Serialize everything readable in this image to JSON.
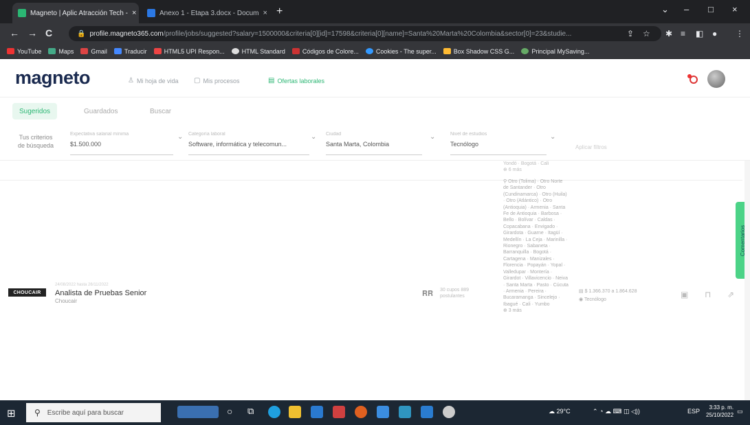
{
  "browser": {
    "tabs": [
      {
        "label": "Magneto | Aplic Atracción Tech - ",
        "close": "×"
      },
      {
        "label": "Anexo 1 - Etapa 3.docx - Docum",
        "close": "×"
      }
    ],
    "new_tab": "+",
    "window_controls": {
      "minimize": "–",
      "maximize": "□",
      "close": "×",
      "tab_search": "⌄"
    },
    "nav": {
      "back": "←",
      "forward": "→",
      "reload": "C"
    },
    "url_host": "profile.magneto365.com",
    "url_rest": "/profile/jobs/suggested?salary=1500000&criteria[0][id]=17598&criteria[0][name]=Santa%20Marta%20Colombia&sector[0]=23&studie...",
    "bookmarks": [
      "YouTube",
      "Maps",
      "Gmail",
      "Traducir",
      "HTML5 UPI Respon...",
      "HTML Standard",
      "Códigos de Colore...",
      "Cookies - The super...",
      "Box Shadow CSS G...",
      "Principal MySaving..."
    ]
  },
  "site": {
    "logo": "magneto",
    "nav": [
      {
        "label": "Mi hoja de vida"
      },
      {
        "label": "Mis procesos"
      },
      {
        "label": "Ofertas laborales"
      }
    ],
    "subtabs": [
      "Sugeridos",
      "Guardados",
      "Buscar"
    ],
    "filter_label": "Tus criterios de búsqueda",
    "filters": [
      {
        "label": "Expectativa salarial mínima",
        "value": "$1.500.000"
      },
      {
        "label": "Categoría laboral",
        "value": "Software, informática y telecomun..."
      },
      {
        "label": "Ciudad",
        "value": "Santa Marta, Colombia"
      },
      {
        "label": "Nivel de estudios",
        "value": "Tecnólogo"
      }
    ],
    "apply_filters": "Aplicar filtros",
    "comments_tab": "Comentarios"
  },
  "job": {
    "company_logo": "CHOUCAIR",
    "date": "24/08/2022 hasta 26/11/2022",
    "title": "Analista de Pruebas Senior",
    "company": "Choucair",
    "applicants": "30 cupos 889 postulantes",
    "prev_snippet": "Yondó · Bogotá · Cali\n⊕ 6 más",
    "locations": "⚲ Otro (Tolima) · Otro Norte de Santander · Otro (Cundinamarca) · Otro (Huila) · Otro (Atlántico) · Otro (Antioquia) · Armenia · Santa Fe de Antioquia · Barbosa · Bello · Bolívar · Caldas · Copacabana · Envigado · Girardota · Guarne · Itagüí · Medellín · La Ceja · Marinilla · Rionegro · Sabaneta · Barranquilla · Bogotá · Cartagena · Manizales · Florencia · Popayán · Yopal · Valledupar · Montería · Girardot · Villavicencio · Neiva · Santa Marta · Pasto · Cúcuta · Armenia · Pereira · Bucaramanga · Sincelejo · Ibagué · Cali · Yumbo\n⊕ 3 más",
    "salary": "$ 1.366.370 a 1.864.628",
    "level": "Tecnólogo"
  },
  "taskbar": {
    "search_placeholder": "Escribe aquí para buscar",
    "weather": "29°C",
    "lang": "ESP",
    "time": "3:33 p. m.",
    "date": "25/10/2022"
  }
}
